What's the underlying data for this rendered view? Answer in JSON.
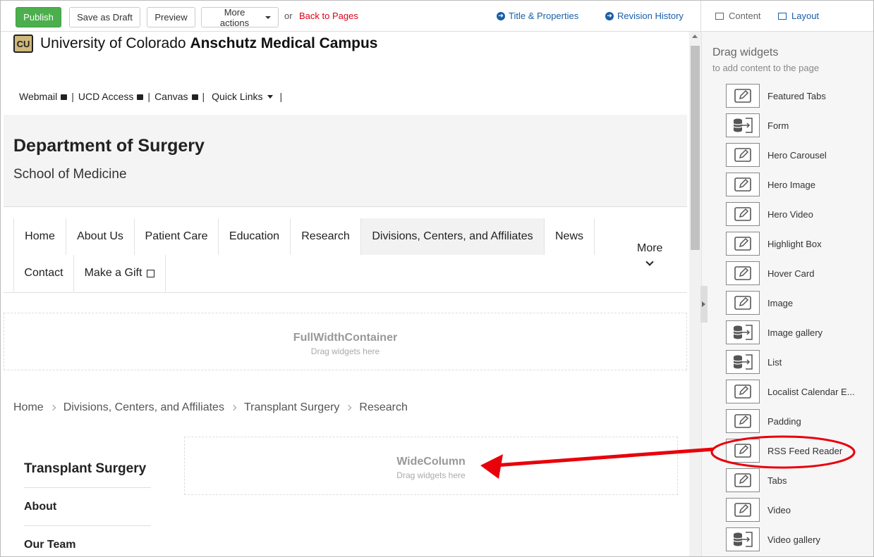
{
  "toolbar": {
    "publish": "Publish",
    "save_draft": "Save as Draft",
    "preview": "Preview",
    "more_actions": "More actions",
    "or": "or",
    "back": "Back to Pages",
    "title_props": "Title & Properties",
    "revision": "Revision History",
    "tab_content": "Content",
    "tab_layout": "Layout"
  },
  "site": {
    "logo": "CU",
    "university": "University of Colorado",
    "campus": "Anschutz Medical Campus",
    "utility": [
      "Webmail",
      "UCD Access",
      "Canvas"
    ],
    "quick_links": "Quick Links",
    "dept": "Department of Surgery",
    "school": "School of Medicine",
    "nav": [
      "Home",
      "About Us",
      "Patient Care",
      "Education",
      "Research",
      "Divisions, Centers, and Affiliates",
      "News",
      "Contact",
      "Make a Gift"
    ],
    "more": "More"
  },
  "containers": {
    "full_name": "FullWidthContainer",
    "full_hint": "Drag widgets here",
    "wide_name": "WideColumn",
    "wide_hint": "Drag widgets here"
  },
  "breadcrumbs": [
    "Home",
    "Divisions, Centers, and Affiliates",
    "Transplant Surgery",
    "Research"
  ],
  "sidebar": {
    "title": "Transplant Surgery",
    "items": [
      "About",
      "Our Team"
    ]
  },
  "panel": {
    "title": "Drag widgets",
    "subtitle": "to add content to the page",
    "widgets": [
      {
        "label": "Featured Tabs",
        "icon": "pencil-edit-icon"
      },
      {
        "label": "Form",
        "icon": "database-import-icon"
      },
      {
        "label": "Hero Carousel",
        "icon": "pencil-edit-icon"
      },
      {
        "label": "Hero Image",
        "icon": "pencil-edit-icon"
      },
      {
        "label": "Hero Video",
        "icon": "pencil-edit-icon"
      },
      {
        "label": "Highlight Box",
        "icon": "pencil-edit-icon"
      },
      {
        "label": "Hover Card",
        "icon": "pencil-edit-icon"
      },
      {
        "label": "Image",
        "icon": "pencil-edit-icon"
      },
      {
        "label": "Image gallery",
        "icon": "database-import-icon"
      },
      {
        "label": "List",
        "icon": "database-import-icon"
      },
      {
        "label": "Localist Calendar E...",
        "icon": "pencil-edit-icon"
      },
      {
        "label": "Padding",
        "icon": "pencil-edit-icon"
      },
      {
        "label": "RSS Feed Reader",
        "icon": "pencil-edit-icon"
      },
      {
        "label": "Tabs",
        "icon": "pencil-edit-icon"
      },
      {
        "label": "Video",
        "icon": "pencil-edit-icon"
      },
      {
        "label": "Video gallery",
        "icon": "database-import-icon"
      }
    ]
  },
  "colors": {
    "publish": "#4cae4c",
    "link": "#1a5fa8",
    "back": "#d9001b",
    "annotation": "#e8000b",
    "gold": "#cfb87c"
  }
}
